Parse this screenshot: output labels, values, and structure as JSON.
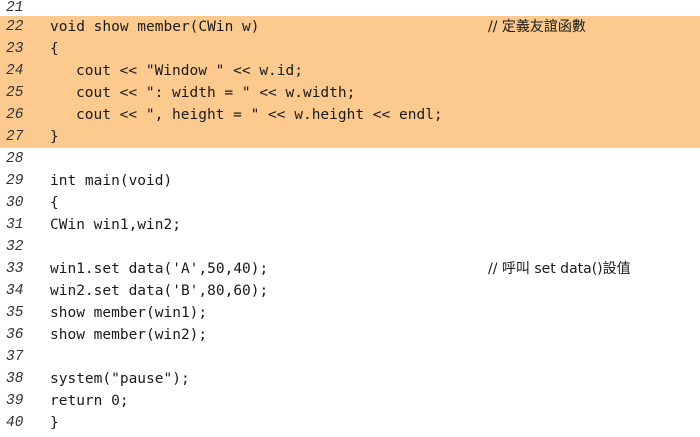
{
  "colors": {
    "highlight": "#fcc98e",
    "text": "#1a1a1a"
  },
  "lines": [
    {
      "num": "21",
      "code": "",
      "comment": "",
      "highlight": false,
      "indent": 0
    },
    {
      "num": "22",
      "code": "void show member(CWin w)",
      "comment": "// 定義友誼函數",
      "highlight": true,
      "indent": 0
    },
    {
      "num": "23",
      "code": "{",
      "comment": "",
      "highlight": true,
      "indent": 0
    },
    {
      "num": "24",
      "code": "cout << \"Window \" << w.id;",
      "comment": "",
      "highlight": true,
      "indent": 2
    },
    {
      "num": "25",
      "code": "cout << \": width = \" << w.width;",
      "comment": "",
      "highlight": true,
      "indent": 2
    },
    {
      "num": "26",
      "code": "cout << \", height = \" << w.height << endl;",
      "comment": "",
      "highlight": true,
      "indent": 2
    },
    {
      "num": "27",
      "code": "}",
      "comment": "",
      "highlight": true,
      "indent": 0
    },
    {
      "num": "28",
      "code": "",
      "comment": "",
      "highlight": false,
      "indent": 0
    },
    {
      "num": "29",
      "code": "int main(void)",
      "comment": "",
      "highlight": false,
      "indent": 0
    },
    {
      "num": "30",
      "code": "{",
      "comment": "",
      "highlight": false,
      "indent": 0
    },
    {
      "num": "31",
      "code": "CWin win1,win2;",
      "comment": "",
      "highlight": false,
      "indent": 1
    },
    {
      "num": "32",
      "code": "",
      "comment": "",
      "highlight": false,
      "indent": 0
    },
    {
      "num": "33",
      "code": "win1.set data('A',50,40);",
      "comment": "// 呼叫 set data()設值",
      "highlight": false,
      "indent": 1
    },
    {
      "num": "34",
      "code": "win2.set data('B',80,60);",
      "comment": "",
      "highlight": false,
      "indent": 1
    },
    {
      "num": "35",
      "code": "show member(win1);",
      "comment": "",
      "highlight": false,
      "indent": 1
    },
    {
      "num": "36",
      "code": "show member(win2);",
      "comment": "",
      "highlight": false,
      "indent": 1
    },
    {
      "num": "37",
      "code": "",
      "comment": "",
      "highlight": false,
      "indent": 0
    },
    {
      "num": "38",
      "code": "system(\"pause\");",
      "comment": "",
      "highlight": false,
      "indent": 1
    },
    {
      "num": "39",
      "code": "return 0;",
      "comment": "",
      "highlight": false,
      "indent": 1
    },
    {
      "num": "40",
      "code": "}",
      "comment": "",
      "highlight": false,
      "indent": 0
    }
  ]
}
